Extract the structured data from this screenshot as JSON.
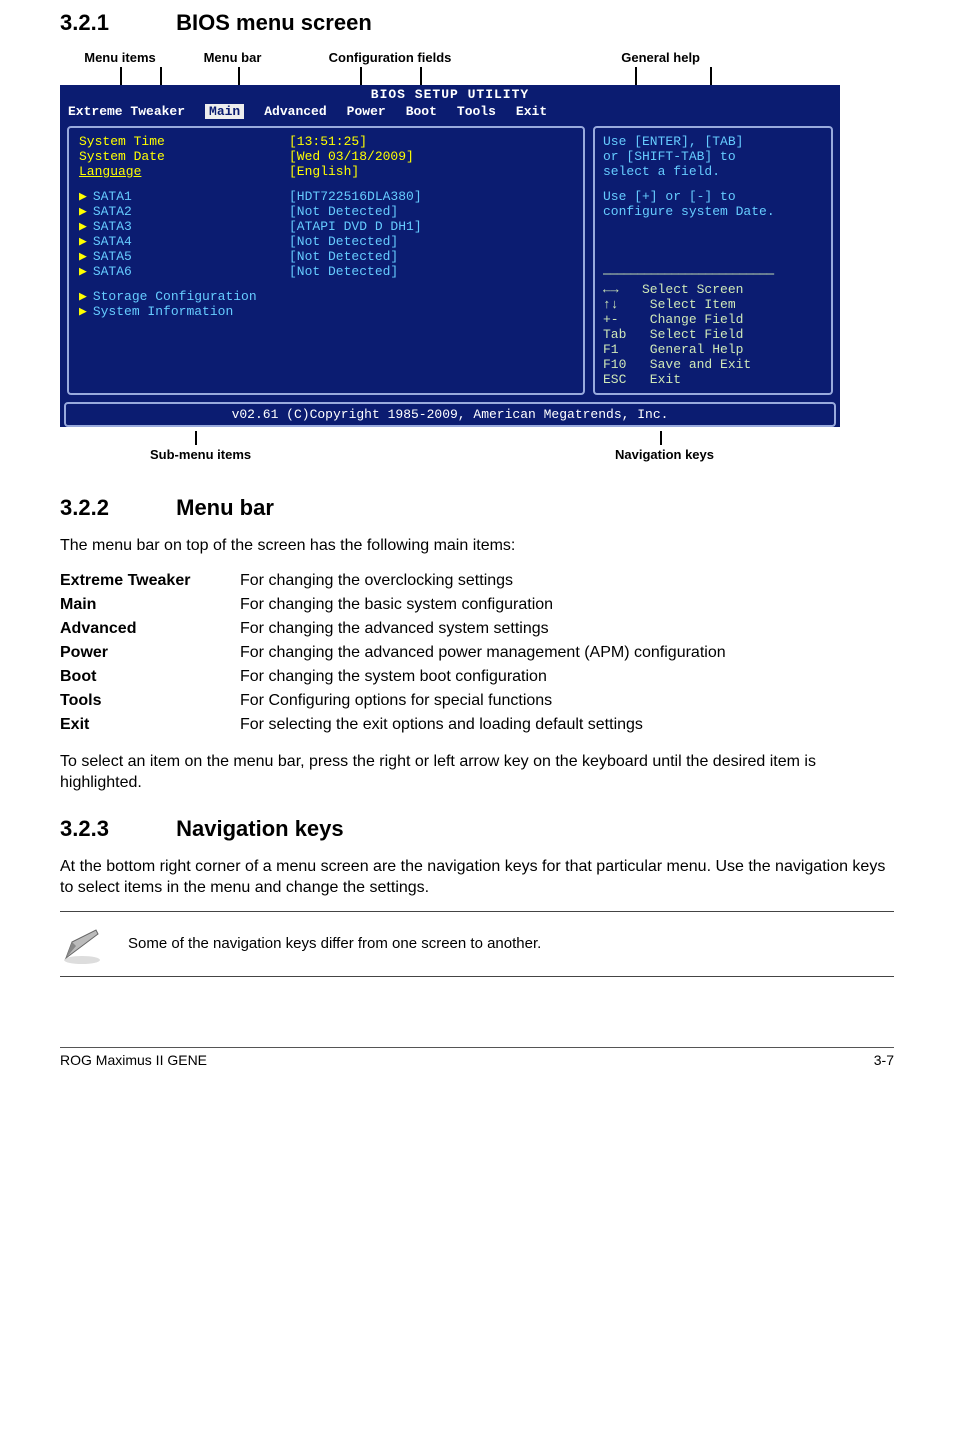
{
  "sections": {
    "s321": {
      "num": "3.2.1",
      "title": "BIOS menu screen"
    },
    "s322": {
      "num": "3.2.2",
      "title": "Menu bar"
    },
    "s323": {
      "num": "3.2.3",
      "title": "Navigation keys"
    }
  },
  "top_annot": {
    "a": "Menu items",
    "b": "Menu bar",
    "c": "Configuration fields",
    "d": "General help"
  },
  "bios": {
    "title": "BIOS SETUP UTILITY",
    "menubar": [
      "Extreme Tweaker",
      "Main",
      "Advanced",
      "Power",
      "Boot",
      "Tools",
      "Exit"
    ],
    "left_items_top": [
      {
        "lbl": "System Time",
        "val": "[13:51:25]"
      },
      {
        "lbl": "System Date",
        "val": "[Wed 03/18/2009]"
      },
      {
        "lbl": "Language",
        "val": "[English]"
      }
    ],
    "sata": [
      {
        "lbl": "SATA1",
        "val": "[HDT722516DLA380]"
      },
      {
        "lbl": "SATA2",
        "val": "[Not Detected]"
      },
      {
        "lbl": "SATA3",
        "val": "[ATAPI DVD D DH1]"
      },
      {
        "lbl": "SATA4",
        "val": "[Not Detected]"
      },
      {
        "lbl": "SATA5",
        "val": "[Not Detected]"
      },
      {
        "lbl": "SATA6",
        "val": "[Not Detected]"
      }
    ],
    "sub1": "Storage Configuration",
    "sub2": "System Information",
    "help1": "Use [ENTER], [TAB]",
    "help2": "or [SHIFT-TAB] to",
    "help3": "select a field.",
    "help4": "Use [+] or [-] to",
    "help5": "configure system Date.",
    "keys": "←→   Select Screen\n↑↓    Select Item\n+-    Change Field\nTab   Select Field\nF1    General Help\nF10   Save and Exit\nESC   Exit",
    "footer": "v02.61 (C)Copyright 1985-2009, American Megatrends, Inc."
  },
  "bot_annot": {
    "a": "Sub-menu items",
    "b": "Navigation keys"
  },
  "menubar_intro": "The menu bar on top of the screen has the following main items:",
  "defs": [
    [
      "Extreme Tweaker",
      "For changing the overclocking settings"
    ],
    [
      "Main",
      "For changing the basic system configuration"
    ],
    [
      "Advanced",
      "For changing the advanced system settings"
    ],
    [
      "Power",
      "For changing the advanced power management (APM) configuration"
    ],
    [
      "Boot",
      "For changing the system boot configuration"
    ],
    [
      "Tools",
      "For Configuring options for special functions"
    ],
    [
      "Exit",
      "For selecting the exit options and loading default settings"
    ]
  ],
  "menubar_outro": "To select an item on the menu bar, press the right or left arrow key on the keyboard until the desired item is highlighted.",
  "navkeys_para": "At the bottom right corner of a menu screen are the navigation keys for that particular menu. Use the navigation keys to select items in the menu and change the settings.",
  "note": "Some of the navigation keys differ from one screen to another.",
  "footer_left": "ROG Maximus II GENE",
  "footer_right": "3-7"
}
